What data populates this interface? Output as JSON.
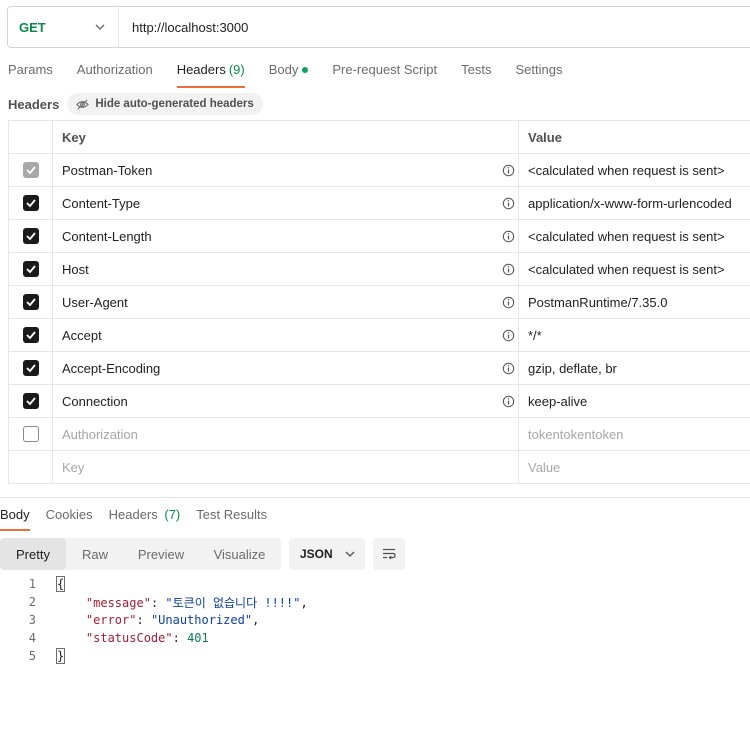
{
  "request": {
    "method": "GET",
    "url": "http://localhost:3000"
  },
  "request_tabs": [
    {
      "label": "Params"
    },
    {
      "label": "Authorization"
    },
    {
      "label": "Headers",
      "count": "(9)"
    },
    {
      "label": "Body"
    },
    {
      "label": "Pre-request Script"
    },
    {
      "label": "Tests"
    },
    {
      "label": "Settings"
    }
  ],
  "headers_section": {
    "title": "Headers",
    "hide_button": "Hide auto-generated headers"
  },
  "table": {
    "columns": {
      "key": "Key",
      "value": "Value"
    },
    "rows": [
      {
        "key": "Postman-Token",
        "value": "<calculated when request is sent>"
      },
      {
        "key": "Content-Type",
        "value": "application/x-www-form-urlencoded"
      },
      {
        "key": "Content-Length",
        "value": "<calculated when request is sent>"
      },
      {
        "key": "Host",
        "value": "<calculated when request is sent>"
      },
      {
        "key": "User-Agent",
        "value": "PostmanRuntime/7.35.0"
      },
      {
        "key": "Accept",
        "value": "*/*"
      },
      {
        "key": "Accept-Encoding",
        "value": "gzip, deflate, br"
      },
      {
        "key": "Connection",
        "value": "keep-alive"
      },
      {
        "key": "Authorization",
        "value": "tokentokentoken"
      }
    ],
    "placeholder": {
      "key": "Key",
      "value": "Value"
    }
  },
  "response_tabs": [
    {
      "label": "Body"
    },
    {
      "label": "Cookies"
    },
    {
      "label": "Headers",
      "count": "(7)"
    },
    {
      "label": "Test Results"
    }
  ],
  "view_modes": [
    "Pretty",
    "Raw",
    "Preview",
    "Visualize"
  ],
  "format": "JSON",
  "response_body": {
    "line_numbers": [
      "1",
      "2",
      "3",
      "4",
      "5"
    ],
    "open_brace": "{",
    "close_brace": "}",
    "fields": [
      {
        "key": "\"message\"",
        "value": "\"토큰이 없습니다 !!!!\""
      },
      {
        "key": "\"error\"",
        "value": "\"Unauthorized\""
      },
      {
        "key": "\"statusCode\"",
        "value": "401"
      }
    ]
  },
  "colors": {
    "accent": "#f26b3a",
    "method_get": "#0b8a4a",
    "json_key": "#a21c33",
    "json_string": "#0d3f9e",
    "json_number": "#0b7c52"
  }
}
